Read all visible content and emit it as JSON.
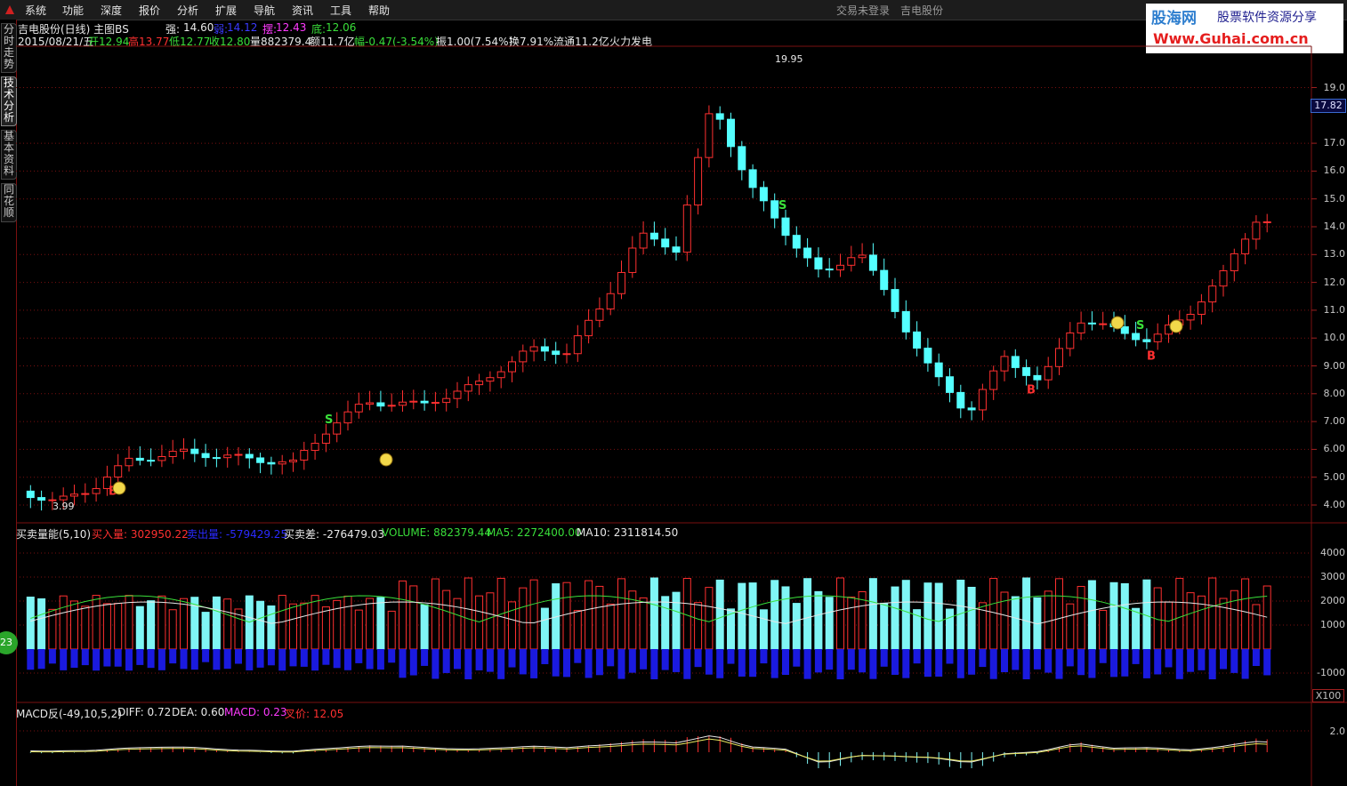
{
  "menu": [
    "系统",
    "功能",
    "深度",
    "报价",
    "分析",
    "扩展",
    "导航",
    "资讯",
    "工具",
    "帮助"
  ],
  "status": {
    "login": "交易未登录",
    "stock": "吉电股份"
  },
  "brand": {
    "name": "股海网",
    "slogan": "股票软件资源分享",
    "url": "Www.Guhai.com.cn"
  },
  "sidetabs": [
    "分时走势",
    "技术分析",
    "基本资料",
    "同花顺"
  ],
  "header": {
    "title": "吉电股份(日线) 主图BS",
    "strong_label": "强:",
    "strong_value": "14.60",
    "weak_label": "弱:",
    "weak_value": "14.12",
    "swing_label": "摆:",
    "swing_value": "12.43",
    "bottom_label": "底:",
    "bottom_value": "12.06",
    "date": "2015/08/21/五",
    "open": "开12.94",
    "high": "高13.77",
    "low": "低12.77",
    "close": "收12.80",
    "volume": "量882379.4",
    "amount": "额11.7亿",
    "change": "幅-0.47(-3.54%)",
    "amplitude": "振1.00(7.54%)",
    "turnover": "换7.91%",
    "float": "流通11.2亿",
    "sector": "火力发电"
  },
  "price_axis": [
    "19.0",
    "17.0",
    "16.0",
    "15.0",
    "14.0",
    "13.0",
    "12.0",
    "11.0",
    "10.0",
    "9.00",
    "8.00",
    "7.00",
    "6.00",
    "5.00",
    "4.00"
  ],
  "price_tag": "17.82",
  "annotations": {
    "high_label": "19.95",
    "low_label": "3.99"
  },
  "volume_panel": {
    "title": "买卖量能(5,10)",
    "buy_label": "买入量: 302950.22",
    "sell_label": "卖出量: -579429.25",
    "diff_label": "买卖差: -276479.03",
    "volume_label": "VOLUME: 882379.44",
    "ma5_label": "MA5: 2272400.00",
    "ma10_label": "MA10: 2311814.50",
    "axis": [
      "4000",
      "3000",
      "2000",
      "1000",
      "-1000"
    ],
    "scale": "X100"
  },
  "macd_panel": {
    "title": "MACD反(-49,10,5,2)",
    "diff": "DIFF: 0.72",
    "dea": "DEA: 0.60",
    "macd": "MACD: 0.23",
    "cross": "叉价: 12.05",
    "axis": [
      "2.0"
    ]
  },
  "float_button": "23",
  "colors": {
    "up": "#ff3030",
    "down": "#54ffff",
    "grid": "#7a1010",
    "volume_sell": "#1a1adf"
  }
}
